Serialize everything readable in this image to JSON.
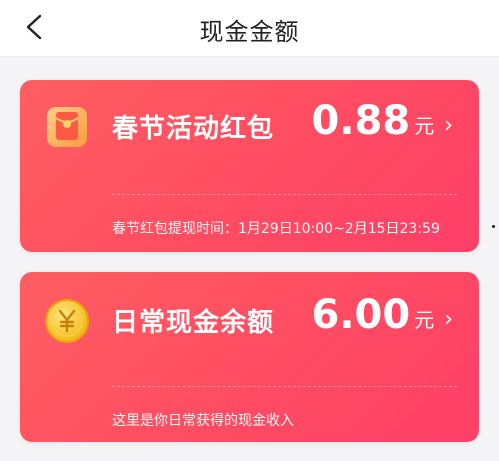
{
  "header": {
    "title": "现金金额"
  },
  "cards": [
    {
      "name": "春节活动红包",
      "amount": "0.88",
      "unit": "元",
      "chevron": "›",
      "note": "春节红包提现时间：1月29日10:00~2月15日23:59",
      "icon": "red-envelope-icon"
    },
    {
      "name": "日常现金余额",
      "amount": "6.00",
      "unit": "元",
      "chevron": "›",
      "note": "这里是你日常获得的现金收入",
      "icon": "yen-coin-icon"
    }
  ],
  "colors": {
    "card_gradient_start": "#ff5f63",
    "card_gradient_end": "#ff3f68",
    "background": "#f4f4f6",
    "coin": "#f6c21c"
  }
}
